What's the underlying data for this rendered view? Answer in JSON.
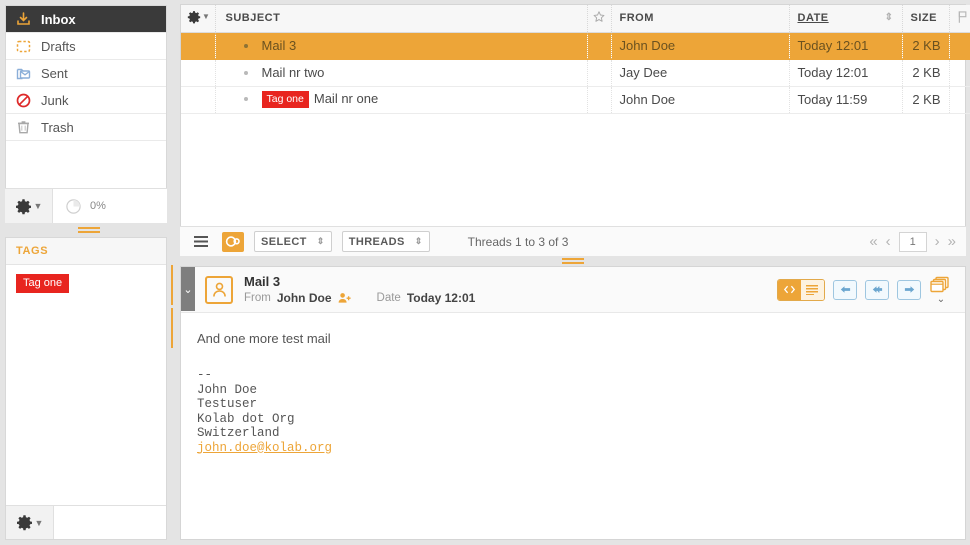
{
  "sidebar": {
    "folders": [
      {
        "label": "Inbox",
        "icon": "inbox-icon",
        "selected": true
      },
      {
        "label": "Drafts",
        "icon": "drafts-icon",
        "selected": false
      },
      {
        "label": "Sent",
        "icon": "sent-icon",
        "selected": false
      },
      {
        "label": "Junk",
        "icon": "junk-icon",
        "selected": false
      },
      {
        "label": "Trash",
        "icon": "trash-icon",
        "selected": false
      }
    ],
    "quota": {
      "percent": "0%",
      "gear_icon": "gear-icon",
      "caret_icon": "chevron-down-icon"
    },
    "tags": {
      "title": "TAGS",
      "items": [
        {
          "label": "Tag one",
          "color": "#e8251f"
        }
      ],
      "footer_gear_icon": "gear-icon"
    }
  },
  "message_list": {
    "header": {
      "options_icon": "gear-icon",
      "subject": "SUBJECT",
      "star": "star-icon",
      "from": "FROM",
      "date": "DATE",
      "size": "SIZE",
      "flag": "flag-icon",
      "attachment": "paperclip-icon",
      "sort_column": "DATE",
      "sort_icon": "sort-updown-icon"
    },
    "rows": [
      {
        "subject": "Mail 3",
        "tag": "",
        "from": "John Doe",
        "date": "Today 12:01",
        "size": "2 KB",
        "selected": true
      },
      {
        "subject": "Mail nr two",
        "tag": "",
        "from": "Jay Dee",
        "date": "Today 12:01",
        "size": "2 KB",
        "selected": false
      },
      {
        "subject": "Mail nr one",
        "tag": "Tag one",
        "from": "John Doe",
        "date": "Today 11:59",
        "size": "2 KB",
        "selected": false
      }
    ],
    "footer": {
      "list_icon": "list-mode-icon",
      "threads_toggle_icon": "conversation-icon",
      "select_label": "SELECT",
      "threads_label": "THREADS",
      "count_text": "Threads 1 to 3 of 3",
      "first_icon": "double-left-icon",
      "prev_icon": "left-icon",
      "page_value": "1",
      "next_icon": "right-icon",
      "last_icon": "double-right-icon"
    }
  },
  "preview": {
    "collapse_icon": "chevron-down-icon",
    "avatar_icon": "contact-avatar-icon",
    "subject": "Mail 3",
    "from_label": "From",
    "from_name": "John Doe",
    "add_contact_icon": "add-contact-icon",
    "date_label": "Date",
    "date_value": "Today 12:01",
    "actions": {
      "source_icon": "code-view-icon",
      "html_icon": "text-view-icon",
      "reply_icon": "reply-icon",
      "reply_all_icon": "reply-all-icon",
      "forward_icon": "forward-icon",
      "folder_icon": "copy-to-folder-icon",
      "more_icon": "chevron-down-icon"
    },
    "body": {
      "text": "And one more test mail",
      "signature_lines": [
        "--",
        "John Doe",
        "Testuser",
        "Kolab dot Org",
        "Switzerland"
      ],
      "signature_email": "john.doe@kolab.org"
    }
  },
  "colors": {
    "accent": "#eda538",
    "tag": "#e8251f",
    "selected_folder": "#3a3a3a"
  }
}
